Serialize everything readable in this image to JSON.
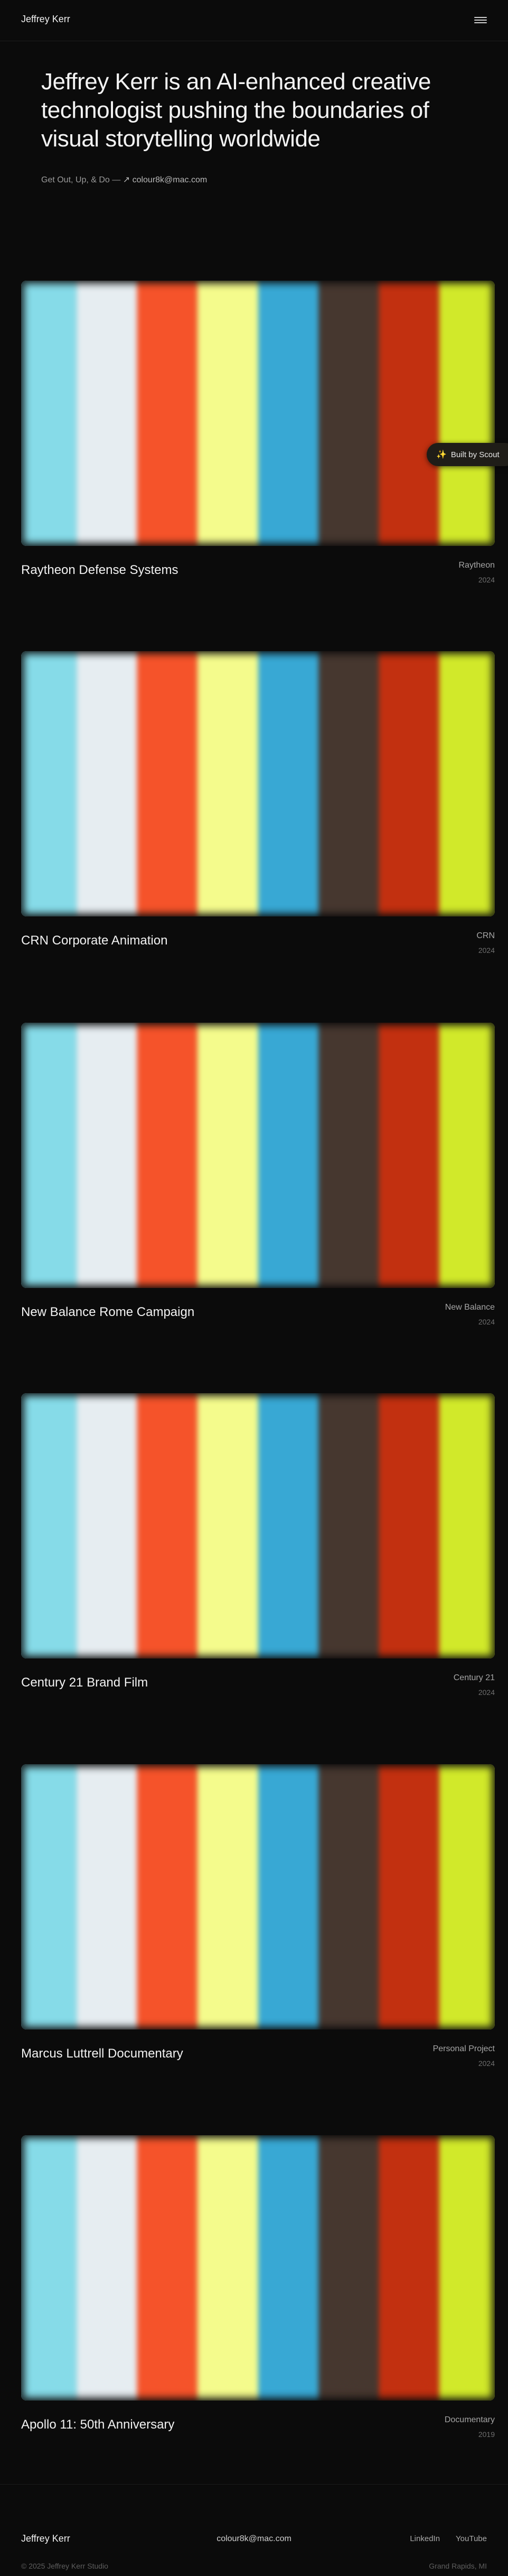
{
  "header": {
    "brand": "Jeffrey Kerr",
    "menu_icon": "hamburger-menu-icon"
  },
  "hero": {
    "title": "Jeffrey Kerr is an AI-enhanced creative technologist pushing the boundaries of visual storytelling worldwide",
    "tagline": "Get Out, Up, & Do — ",
    "email_link": "↗ colour8k@mac.com"
  },
  "thumbnail_colors": [
    "#86dbe8",
    "#e6edf1",
    "#f5532a",
    "#f4fb8c",
    "#38a8d4",
    "#46372f",
    "#c23010",
    "#d1e92a"
  ],
  "projects": [
    {
      "title": "Raytheon Defense Systems",
      "client": "Raytheon",
      "year": "2024"
    },
    {
      "title": "CRN Corporate Animation",
      "client": "CRN",
      "year": "2024"
    },
    {
      "title": "New Balance Rome Campaign",
      "client": "New Balance",
      "year": "2024"
    },
    {
      "title": "Century 21 Brand Film",
      "client": "Century 21",
      "year": "2024"
    },
    {
      "title": "Marcus Luttrell Documentary",
      "client": "Personal Project",
      "year": "2024"
    },
    {
      "title": "Apollo 11: 50th Anniversary",
      "client": "Documentary",
      "year": "2019"
    }
  ],
  "badge": {
    "icon": "sparkle-icon",
    "label": "Built by Scout"
  },
  "footer": {
    "brand": "Jeffrey Kerr",
    "email": "colour8k@mac.com",
    "links": [
      "LinkedIn",
      "YouTube"
    ],
    "copyright": "© 2025 Jeffrey Kerr Studio",
    "location": "Grand Rapids, MI"
  }
}
